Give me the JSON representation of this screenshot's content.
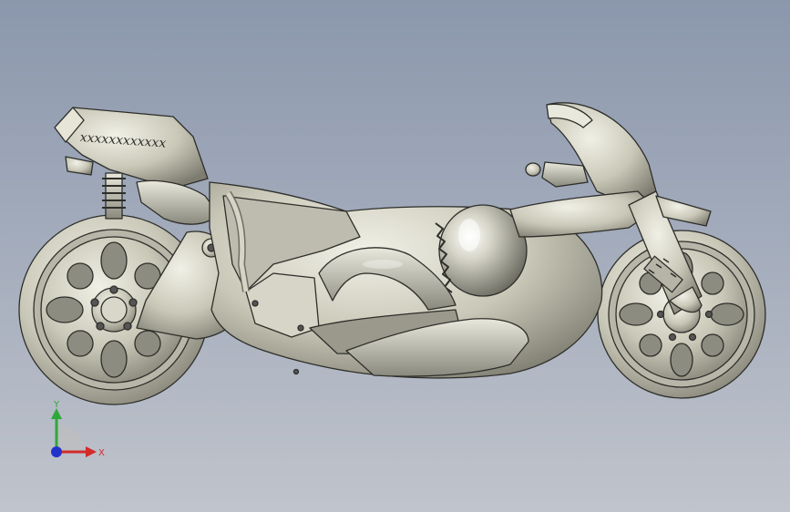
{
  "viewport": {
    "background_top": "#8b97ac",
    "background_bottom": "#c0c4cc"
  },
  "model": {
    "decal_text": "xxxxxxxxxxxx",
    "body_color": "#c9c8b8",
    "shadow_color": "#8e8d80",
    "outline_color": "#2e2e2a"
  },
  "triad": {
    "y_label": "Y",
    "x_label": "X",
    "y_color": "#2ea83a",
    "x_color": "#d42a2a",
    "z_color": "#2233cc"
  }
}
